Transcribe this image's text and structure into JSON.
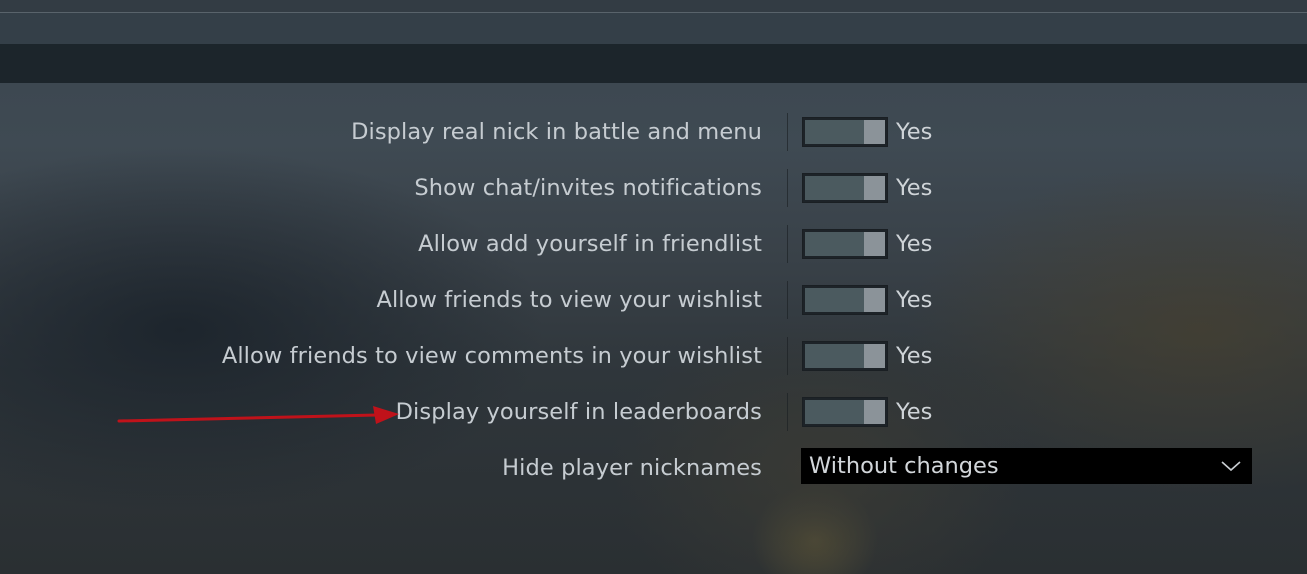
{
  "settings": {
    "rows": [
      {
        "label": "Display real nick in battle and menu",
        "value": "Yes"
      },
      {
        "label": "Show chat/invites notifications",
        "value": "Yes"
      },
      {
        "label": "Allow add yourself in friendlist",
        "value": "Yes"
      },
      {
        "label": "Allow friends to view your wishlist",
        "value": "Yes"
      },
      {
        "label": "Allow friends to view comments in your wishlist",
        "value": "Yes"
      },
      {
        "label": "Display yourself in leaderboards",
        "value": "Yes"
      }
    ],
    "dropdown": {
      "label": "Hide player nicknames",
      "value": "Without changes"
    }
  },
  "colors": {
    "annotation_arrow": "#c0121a",
    "dropdown_background": "#000000",
    "toggle_track": "#4b5a5f",
    "toggle_knob": "#8b9399"
  },
  "icons": {
    "dropdown": "chevron-down-icon",
    "annotation": "red-arrow-icon"
  }
}
